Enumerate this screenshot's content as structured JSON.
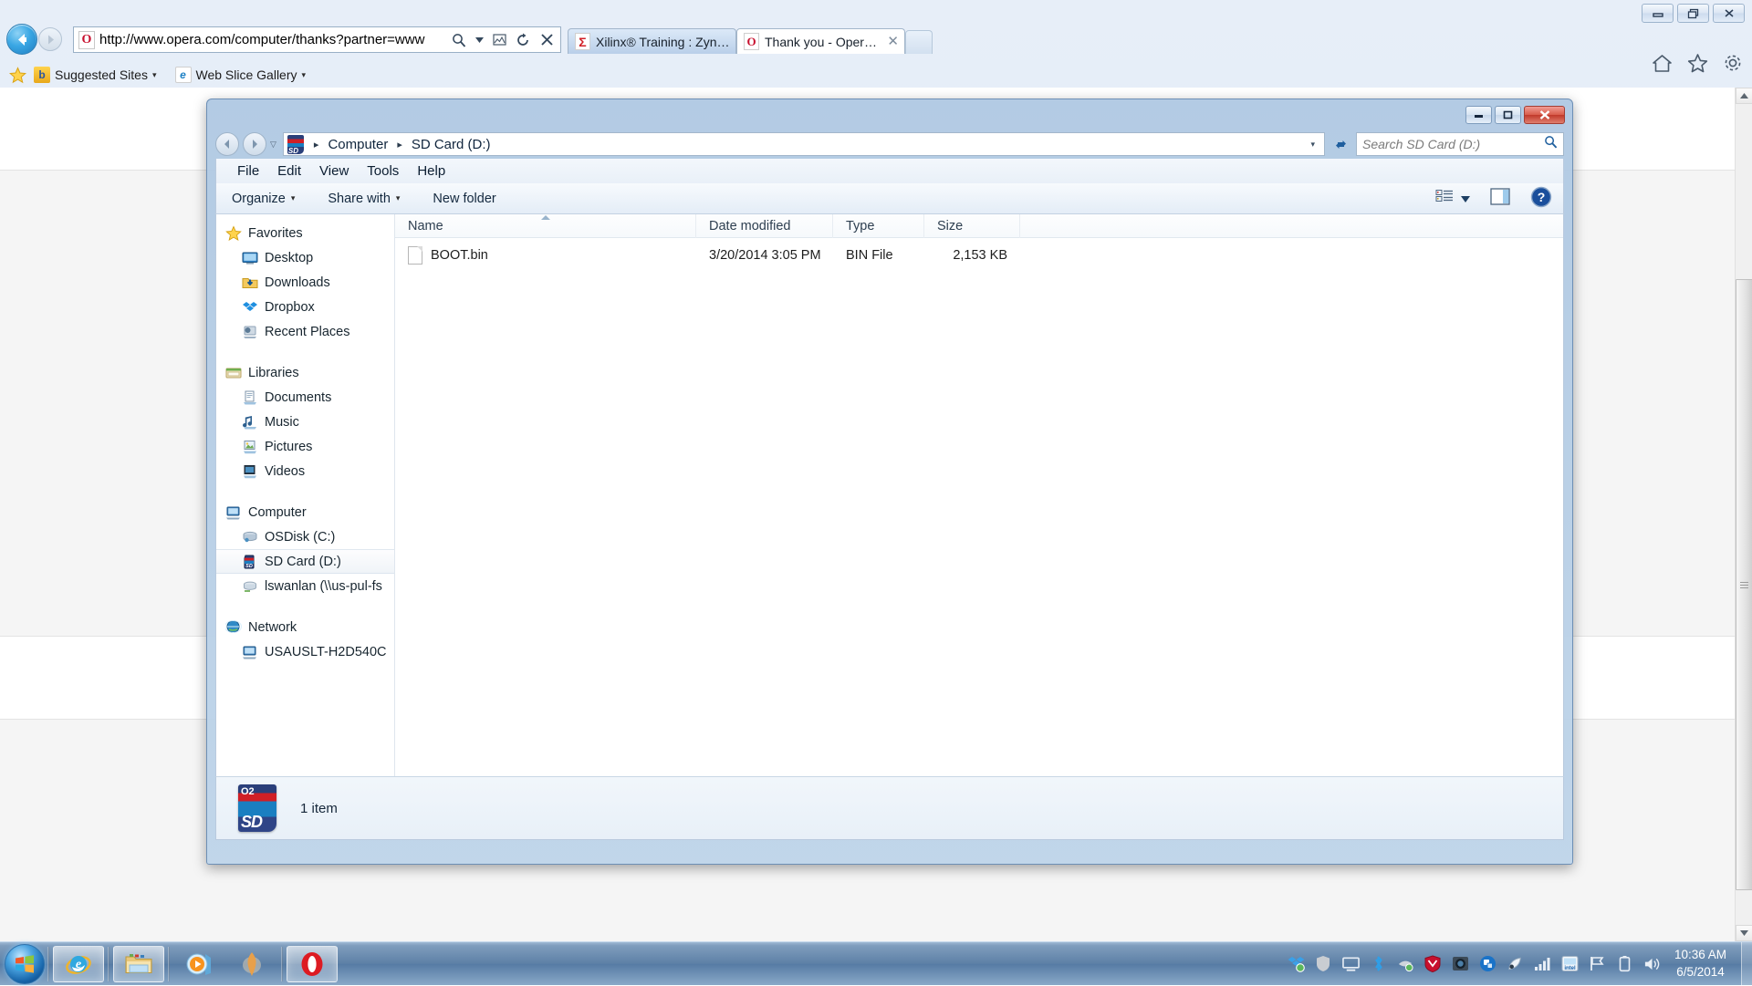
{
  "browser": {
    "address": "http://www.opera.com/computer/thanks?partner=www",
    "address_icon": "opera-favicon",
    "search_icon": "search-icon",
    "compat_icon": "compatibility-view-icon",
    "refresh_icon": "refresh-icon",
    "stop_icon": "stop-icon",
    "back_icon": "back-arrow-icon",
    "forward_icon": "forward-arrow-icon",
    "window_controls": [
      {
        "name": "minimize-button",
        "glyph": "minimize-icon"
      },
      {
        "name": "restore-button",
        "glyph": "restore-icon"
      },
      {
        "name": "close-button",
        "glyph": "close-icon"
      }
    ],
    "right_icons": [
      {
        "name": "home-icon",
        "label": "Home"
      },
      {
        "name": "favorites-star-icon",
        "label": "Favorites"
      },
      {
        "name": "tools-gear-icon",
        "label": "Tools"
      }
    ],
    "tabs": [
      {
        "label": "Xilinx® Training : Zynq...",
        "icon": "xilinx-favicon",
        "active": false
      },
      {
        "label": "Thank you - Opera ...",
        "icon": "opera-favicon",
        "active": true,
        "close": "✕"
      }
    ],
    "new_tab_label": "",
    "favorites_bar": [
      {
        "label": "Suggested Sites",
        "icon": "suggested-sites-icon",
        "caret": "▾"
      },
      {
        "label": "Web Slice Gallery",
        "icon": "web-slice-gallery-icon",
        "caret": "▾"
      }
    ]
  },
  "explorer": {
    "window_controls": [
      {
        "name": "minimize-button",
        "glyph": "minimize-icon"
      },
      {
        "name": "maximize-button",
        "glyph": "maximize-icon"
      },
      {
        "name": "close-button",
        "glyph": "close-icon"
      }
    ],
    "breadcrumb": {
      "icon": "sd-card-icon",
      "parts": [
        "Computer",
        "SD Card (D:)"
      ],
      "separator": "▸",
      "dropdown": "▾"
    },
    "refresh_label": "refresh-icon",
    "search": {
      "placeholder": "Search SD Card (D:)",
      "icon": "search-icon"
    },
    "menu": [
      "File",
      "Edit",
      "View",
      "Tools",
      "Help"
    ],
    "toolbar": {
      "organize": "Organize",
      "share_with": "Share with",
      "new_folder": "New folder",
      "caret": "▾",
      "view_icon": "view-list-icon",
      "view_caret": "▾",
      "preview_icon": "preview-pane-icon",
      "help_icon": "help-icon"
    },
    "navpane": [
      {
        "label": "Favorites",
        "icon": "favorites-star-icon",
        "level": 0
      },
      {
        "label": "Desktop",
        "icon": "desktop-icon",
        "level": 1
      },
      {
        "label": "Downloads",
        "icon": "downloads-folder-icon",
        "level": 1
      },
      {
        "label": "Dropbox",
        "icon": "dropbox-icon",
        "level": 1
      },
      {
        "label": "Recent Places",
        "icon": "recent-places-icon",
        "level": 1
      },
      {
        "gap": true
      },
      {
        "label": "Libraries",
        "icon": "libraries-icon",
        "level": 0
      },
      {
        "label": "Documents",
        "icon": "documents-library-icon",
        "level": 1
      },
      {
        "label": "Music",
        "icon": "music-library-icon",
        "level": 1
      },
      {
        "label": "Pictures",
        "icon": "pictures-library-icon",
        "level": 1
      },
      {
        "label": "Videos",
        "icon": "videos-library-icon",
        "level": 1
      },
      {
        "gap": true
      },
      {
        "label": "Computer",
        "icon": "computer-icon",
        "level": 0
      },
      {
        "label": "OSDisk (C:)",
        "icon": "hard-drive-icon",
        "level": 1
      },
      {
        "label": "SD Card (D:)",
        "icon": "sd-card-icon",
        "level": 1,
        "selected": true
      },
      {
        "label": "lswanlan (\\\\us-pul-fs",
        "icon": "network-drive-icon",
        "level": 1
      },
      {
        "gap": true
      },
      {
        "label": "Network",
        "icon": "network-globe-icon",
        "level": 0
      },
      {
        "label": "USAUSLT-H2D540C",
        "icon": "network-computer-icon",
        "level": 1
      }
    ],
    "columns": [
      {
        "label": "Name",
        "key": "name",
        "sorted": true
      },
      {
        "label": "Date modified",
        "key": "date"
      },
      {
        "label": "Type",
        "key": "type"
      },
      {
        "label": "Size",
        "key": "size"
      }
    ],
    "files": [
      {
        "name": "BOOT.bin",
        "date": "3/20/2014 3:05 PM",
        "type": "BIN File",
        "size": "2,153 KB",
        "icon": "generic-file-icon"
      }
    ],
    "status": {
      "icon": "sd-card-large-icon",
      "icon_top_text": "O2",
      "icon_bottom_text": "SD",
      "text": "1 item"
    }
  },
  "taskbar": {
    "start_icon": "windows-start-orb",
    "buttons": [
      {
        "name": "taskbar-internet-explorer",
        "icon": "internet-explorer-icon",
        "state": "open"
      },
      {
        "name": "taskbar-windows-explorer",
        "icon": "windows-explorer-folder-icon",
        "state": "open"
      },
      {
        "name": "taskbar-media-player",
        "icon": "media-player-icon",
        "state": "plain"
      },
      {
        "name": "taskbar-unknown-app",
        "icon": "feather-app-icon",
        "state": "plain"
      },
      {
        "name": "taskbar-opera",
        "icon": "opera-icon",
        "state": "open"
      }
    ],
    "tray": [
      {
        "name": "tray-dropbox-icon"
      },
      {
        "name": "tray-shield-icon"
      },
      {
        "name": "tray-display-icon"
      },
      {
        "name": "tray-bluetooth-icon"
      },
      {
        "name": "tray-device-icon"
      },
      {
        "name": "tray-mcafee-icon"
      },
      {
        "name": "tray-camera-icon"
      },
      {
        "name": "tray-sync-icon"
      },
      {
        "name": "tray-satellite-icon"
      },
      {
        "name": "tray-network-signal-icon"
      },
      {
        "name": "tray-intel-icon"
      },
      {
        "name": "tray-action-flag-icon"
      },
      {
        "name": "tray-battery-icon"
      },
      {
        "name": "tray-volume-icon"
      }
    ],
    "clock_time": "10:36 AM",
    "clock_date": "6/5/2014"
  },
  "colors": {
    "ie_chrome": "#e7eef8",
    "explorer_frame": "#afc8e2",
    "accent_blue": "#1f7cc0",
    "close_red": "#c0392b",
    "opera_red": "#c8102e"
  }
}
